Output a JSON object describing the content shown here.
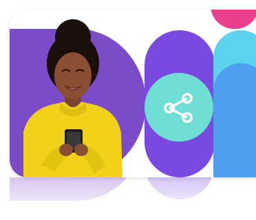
{
  "colors": {
    "photo_background": "#7b4bc9",
    "sweater": "#f2d11b",
    "skin": "#8a4f33",
    "hair": "#1b0f0b",
    "phone": "#1e1e1e",
    "pill_purple": "#7a4ae0",
    "share_circle": "#6fded4",
    "pill_pink": "#ea3f8c",
    "pill_cyan": "#5cd3ee",
    "pill_blue": "#4f9ff1"
  },
  "icons": {
    "share": "share-icon"
  }
}
